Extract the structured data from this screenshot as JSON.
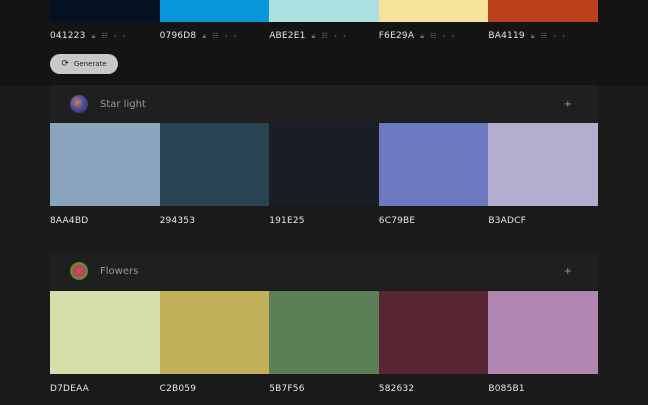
{
  "top_palette": {
    "swatches": [
      {
        "hex": "041223",
        "color": "#041223"
      },
      {
        "hex": "0796D8",
        "color": "#0796D8"
      },
      {
        "hex": "ABE2E1",
        "color": "#ABE2E1"
      },
      {
        "hex": "F6E29A",
        "color": "#F6E29A"
      },
      {
        "hex": "BA4119",
        "color": "#BA4119"
      }
    ]
  },
  "generate": {
    "label": "Generate",
    "icon": "refresh-icon"
  },
  "palettes": [
    {
      "title": "Star light",
      "plus_label": "+",
      "swatches": [
        {
          "hex": "8AA4BD",
          "color": "#8AA4BD"
        },
        {
          "hex": "294353",
          "color": "#294353"
        },
        {
          "hex": "191E25",
          "color": "#191E25"
        },
        {
          "hex": "6C79BE",
          "color": "#6C79BE"
        },
        {
          "hex": "B3ADCF",
          "color": "#B3ADCF"
        }
      ]
    },
    {
      "title": "Flowers",
      "plus_label": "+",
      "swatches": [
        {
          "hex": "D7DEAA",
          "color": "#D7DEAA"
        },
        {
          "hex": "C2B059",
          "color": "#C2B059"
        },
        {
          "hex": "5B7F56",
          "color": "#5B7F56"
        },
        {
          "hex": "582632",
          "color": "#582632"
        },
        {
          "hex": "B085B1",
          "color": "#B085B1"
        }
      ]
    }
  ]
}
